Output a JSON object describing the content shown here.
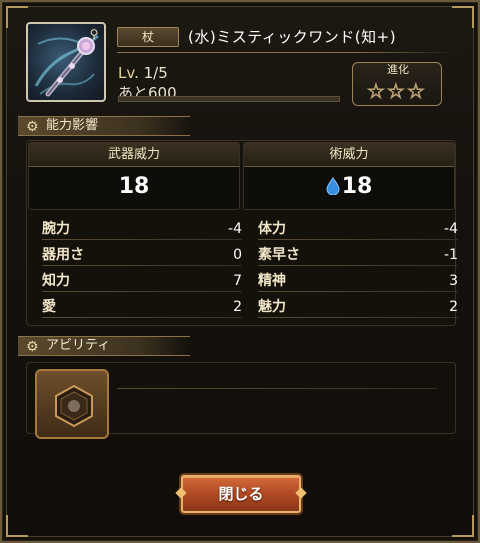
{
  "header": {
    "category": "杖",
    "item_name": "(水)ミスティックワンド(知+)",
    "level_label": "Lv.",
    "level_value": "1/5",
    "exp_text": "あと600",
    "exp_fraction": 0.0,
    "evolution_label": "進化",
    "evolution_stars": "☆☆☆",
    "evolution_level": 0,
    "evolution_max": 3
  },
  "sections": {
    "stats_title": "能力影響",
    "ability_title": "アビリティ"
  },
  "power": {
    "weapon_label": "武器威力",
    "weapon_value": "18",
    "magic_label": "術威力",
    "magic_value": "18",
    "magic_element_icon": "water-drop-icon"
  },
  "stats": [
    {
      "name": "腕力",
      "value": "-4"
    },
    {
      "name": "体力",
      "value": "-4"
    },
    {
      "name": "器用さ",
      "value": "0"
    },
    {
      "name": "素早さ",
      "value": "-1"
    },
    {
      "name": "知力",
      "value": "7"
    },
    {
      "name": "精神",
      "value": "3"
    },
    {
      "name": "愛",
      "value": "2"
    },
    {
      "name": "魅力",
      "value": "2"
    }
  ],
  "buttons": {
    "close_label": "閉じる"
  },
  "colors": {
    "accent_gold": "#b89a5c",
    "close_button": "#b04a24",
    "water_blue": "#3a8ee0"
  }
}
